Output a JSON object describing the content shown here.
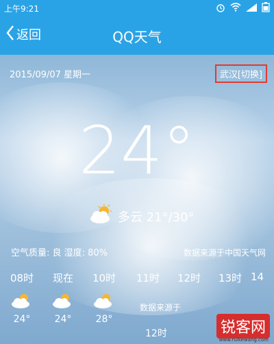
{
  "status_bar": {
    "time": "上午9:21"
  },
  "nav": {
    "back_label": "返回",
    "title": "QQ天气"
  },
  "weather": {
    "date": "2015/09/07 星期一",
    "city_switch": "武汉[切换]",
    "temperature": "24°",
    "condition": "多云 21°/30°",
    "air_info": "空气质量: 良  湿度: 80%",
    "source": "数据来源于中国天气网"
  },
  "hourly": [
    {
      "time": "08时",
      "temp": "24°"
    },
    {
      "time": "现在",
      "temp": "24°"
    },
    {
      "time": "10时",
      "temp": "28°"
    },
    {
      "time": "11时",
      "temp": ""
    },
    {
      "time": "12时",
      "temp": ""
    },
    {
      "time": "13时",
      "temp": ""
    },
    {
      "time": "14",
      "temp": ""
    }
  ],
  "overlay": {
    "source_text": "数据来源于",
    "bottom_time": "12时"
  },
  "watermark": {
    "brand": "锐客网",
    "sub": "www.ruikewang.com"
  },
  "colors": {
    "header": "#2aa3e6",
    "highlight_border": "#e23a2c"
  }
}
